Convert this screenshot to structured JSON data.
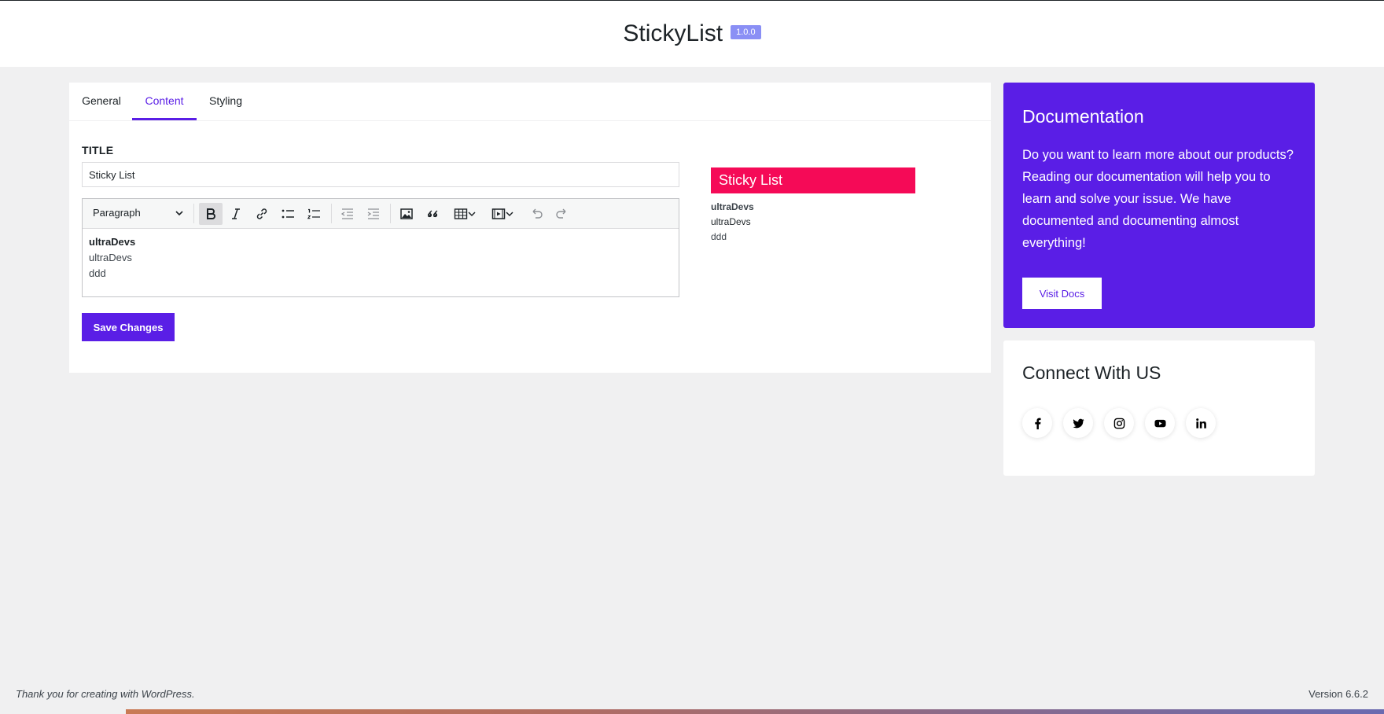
{
  "header": {
    "title": "StickyList",
    "version": "1.0.0"
  },
  "tabs": [
    {
      "label": "General",
      "active": false
    },
    {
      "label": "Content",
      "active": true
    },
    {
      "label": "Styling",
      "active": false
    }
  ],
  "content": {
    "title_label": "TITLE",
    "title_value": "Sticky List",
    "editor": {
      "format": "Paragraph",
      "lines": [
        "ultraDevs",
        "ultraDevs",
        "ddd"
      ]
    },
    "save_label": "Save Changes"
  },
  "preview": {
    "title": "Sticky List",
    "lines": [
      "ultraDevs",
      "ultraDevs",
      "ddd"
    ]
  },
  "docs": {
    "title": "Documentation",
    "text": "Do you want to learn more about our products? Reading our documentation will help you to learn and solve your issue. We have documented and documenting almost everything!",
    "button": "Visit Docs"
  },
  "connect": {
    "title": "Connect With US",
    "icons": [
      "facebook-icon",
      "twitter-icon",
      "instagram-icon",
      "youtube-icon",
      "linkedin-icon"
    ]
  },
  "footer": {
    "left": "Thank you for creating with WordPress.",
    "right": "Version 6.6.2"
  },
  "colors": {
    "accent": "#5a1ee6",
    "preview_title_bg": "#f50a57",
    "page_bg": "#f0f0f1"
  }
}
